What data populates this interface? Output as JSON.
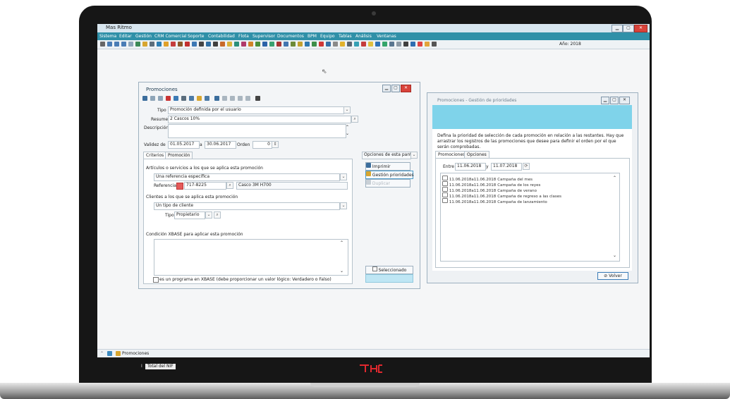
{
  "app": {
    "title": "Mas Ritmo"
  },
  "menu": [
    "Sistema",
    "Editar",
    "Gestión",
    "CRM Comercial",
    "Soporte",
    "Contabilidad",
    "Flota",
    "Supervisor",
    "Documentos",
    "BPM",
    "Equipo",
    "Tablas",
    "Análisis",
    "Ventanas"
  ],
  "toolbar": {
    "year_label": "Año: 2018"
  },
  "promo_window": {
    "title": "Promociones",
    "tipo_label": "Tipo",
    "tipo_value": "Promoción definida por el usuario",
    "resumen_label": "Resumen",
    "resumen_value": "2 Cascos 10%",
    "descripcion_label": "Descripción",
    "validez_label": "Validez de",
    "validez_from": "01.05.2017",
    "validez_sep": "a",
    "validez_to": "30.06.2017",
    "orden_label": "Orden",
    "orden_value": "0",
    "tabs": [
      "Criterios",
      "Promoción"
    ],
    "articulos_label": "Artículos o servicios a los que se aplica esta promoción",
    "articulos_value": "Una referencia específica",
    "referencia_label": "Referencia",
    "referencia_value": "717-8225",
    "referencia_desc": "Casco 3M H700",
    "clientes_label": "Clientes a los que se aplica esta promoción",
    "clientes_value": "Un tipo de cliente",
    "cliente_tipo_label": "Tipo",
    "cliente_tipo_value": "Propietario",
    "condicion_label": "Condición XBASE para aplicar esta promoción",
    "xbase_checkbox_label": "es un programa en XBASE (debe proporcionar un valor lógico: Verdadero o Falso)",
    "opciones_label": "Opciones de esta panta",
    "btn_imprimir": "Imprimir",
    "btn_gestion": "Gestión prioridades",
    "btn_disabled": "Duplicar",
    "seleccionado_label": "Seleccionado"
  },
  "priority_window": {
    "title": "Promociones - Gestión de prioridades",
    "description": "Defina la prioridad de selección de cada promoción en relación a las restantes. Hay que arrastrar los registros de las promociones que desee para definir el orden por el que serán comprobadas.",
    "tabs": [
      "Promociones",
      "Opciones"
    ],
    "entre_label": "Entre",
    "entre_from": "11.06.2018",
    "entre_sep": "y",
    "entre_to": "11.07.2018",
    "items": [
      {
        "dates": "11.06.2018a11.06.2018",
        "name": "Campaña del mes"
      },
      {
        "dates": "11.06.2018a11.06.2018",
        "name": "Campaña de los reyes"
      },
      {
        "dates": "11.06.2018a11.06.2018",
        "name": "Campaña de verano"
      },
      {
        "dates": "11.06.2018a11.06.2018",
        "name": "Campaña de regreso a las clases"
      },
      {
        "dates": "11.06.2018a11.06.2018",
        "name": "Campaña de lanzamiento"
      }
    ],
    "btn_volver": "Volver"
  },
  "taskbar": {
    "item": "Promociones"
  },
  "status": {
    "total_nif": "Total del NIF"
  },
  "colors": {
    "menubar": "#2f90a8",
    "brand_red": "#e0282e",
    "header_band": "#7fd3ea"
  }
}
